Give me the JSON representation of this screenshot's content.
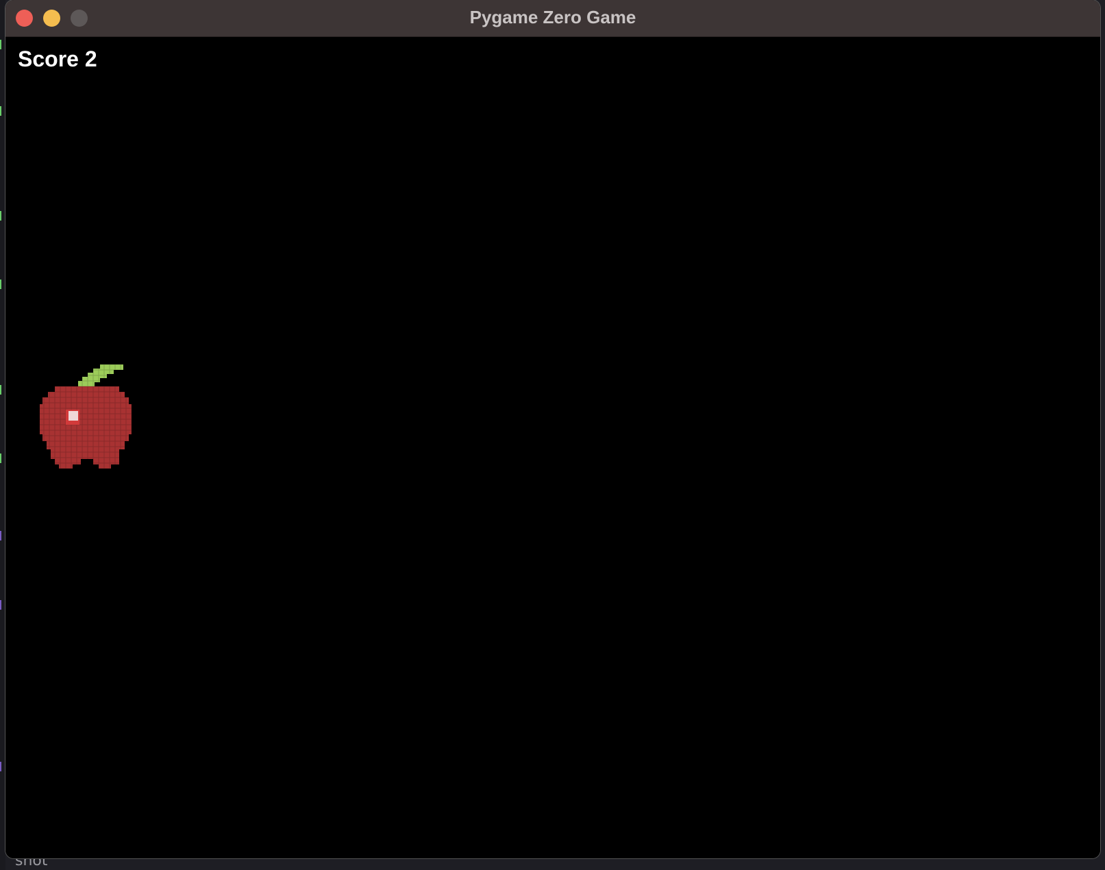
{
  "window": {
    "title": "Pygame Zero Game",
    "controls": [
      {
        "name": "close",
        "color": "#ee5f57"
      },
      {
        "name": "minimize",
        "color": "#f5bd4f"
      },
      {
        "name": "zoom",
        "color": "#5d5858"
      }
    ]
  },
  "game": {
    "score_label": "Score 2",
    "background": "#000000",
    "sprite": {
      "icon": "apple-icon",
      "body_color": "#a83232",
      "leaf_color": "#9ccc5a",
      "highlight_color": "#f0d8d8"
    }
  },
  "backdrop": {
    "caption": "shot"
  }
}
